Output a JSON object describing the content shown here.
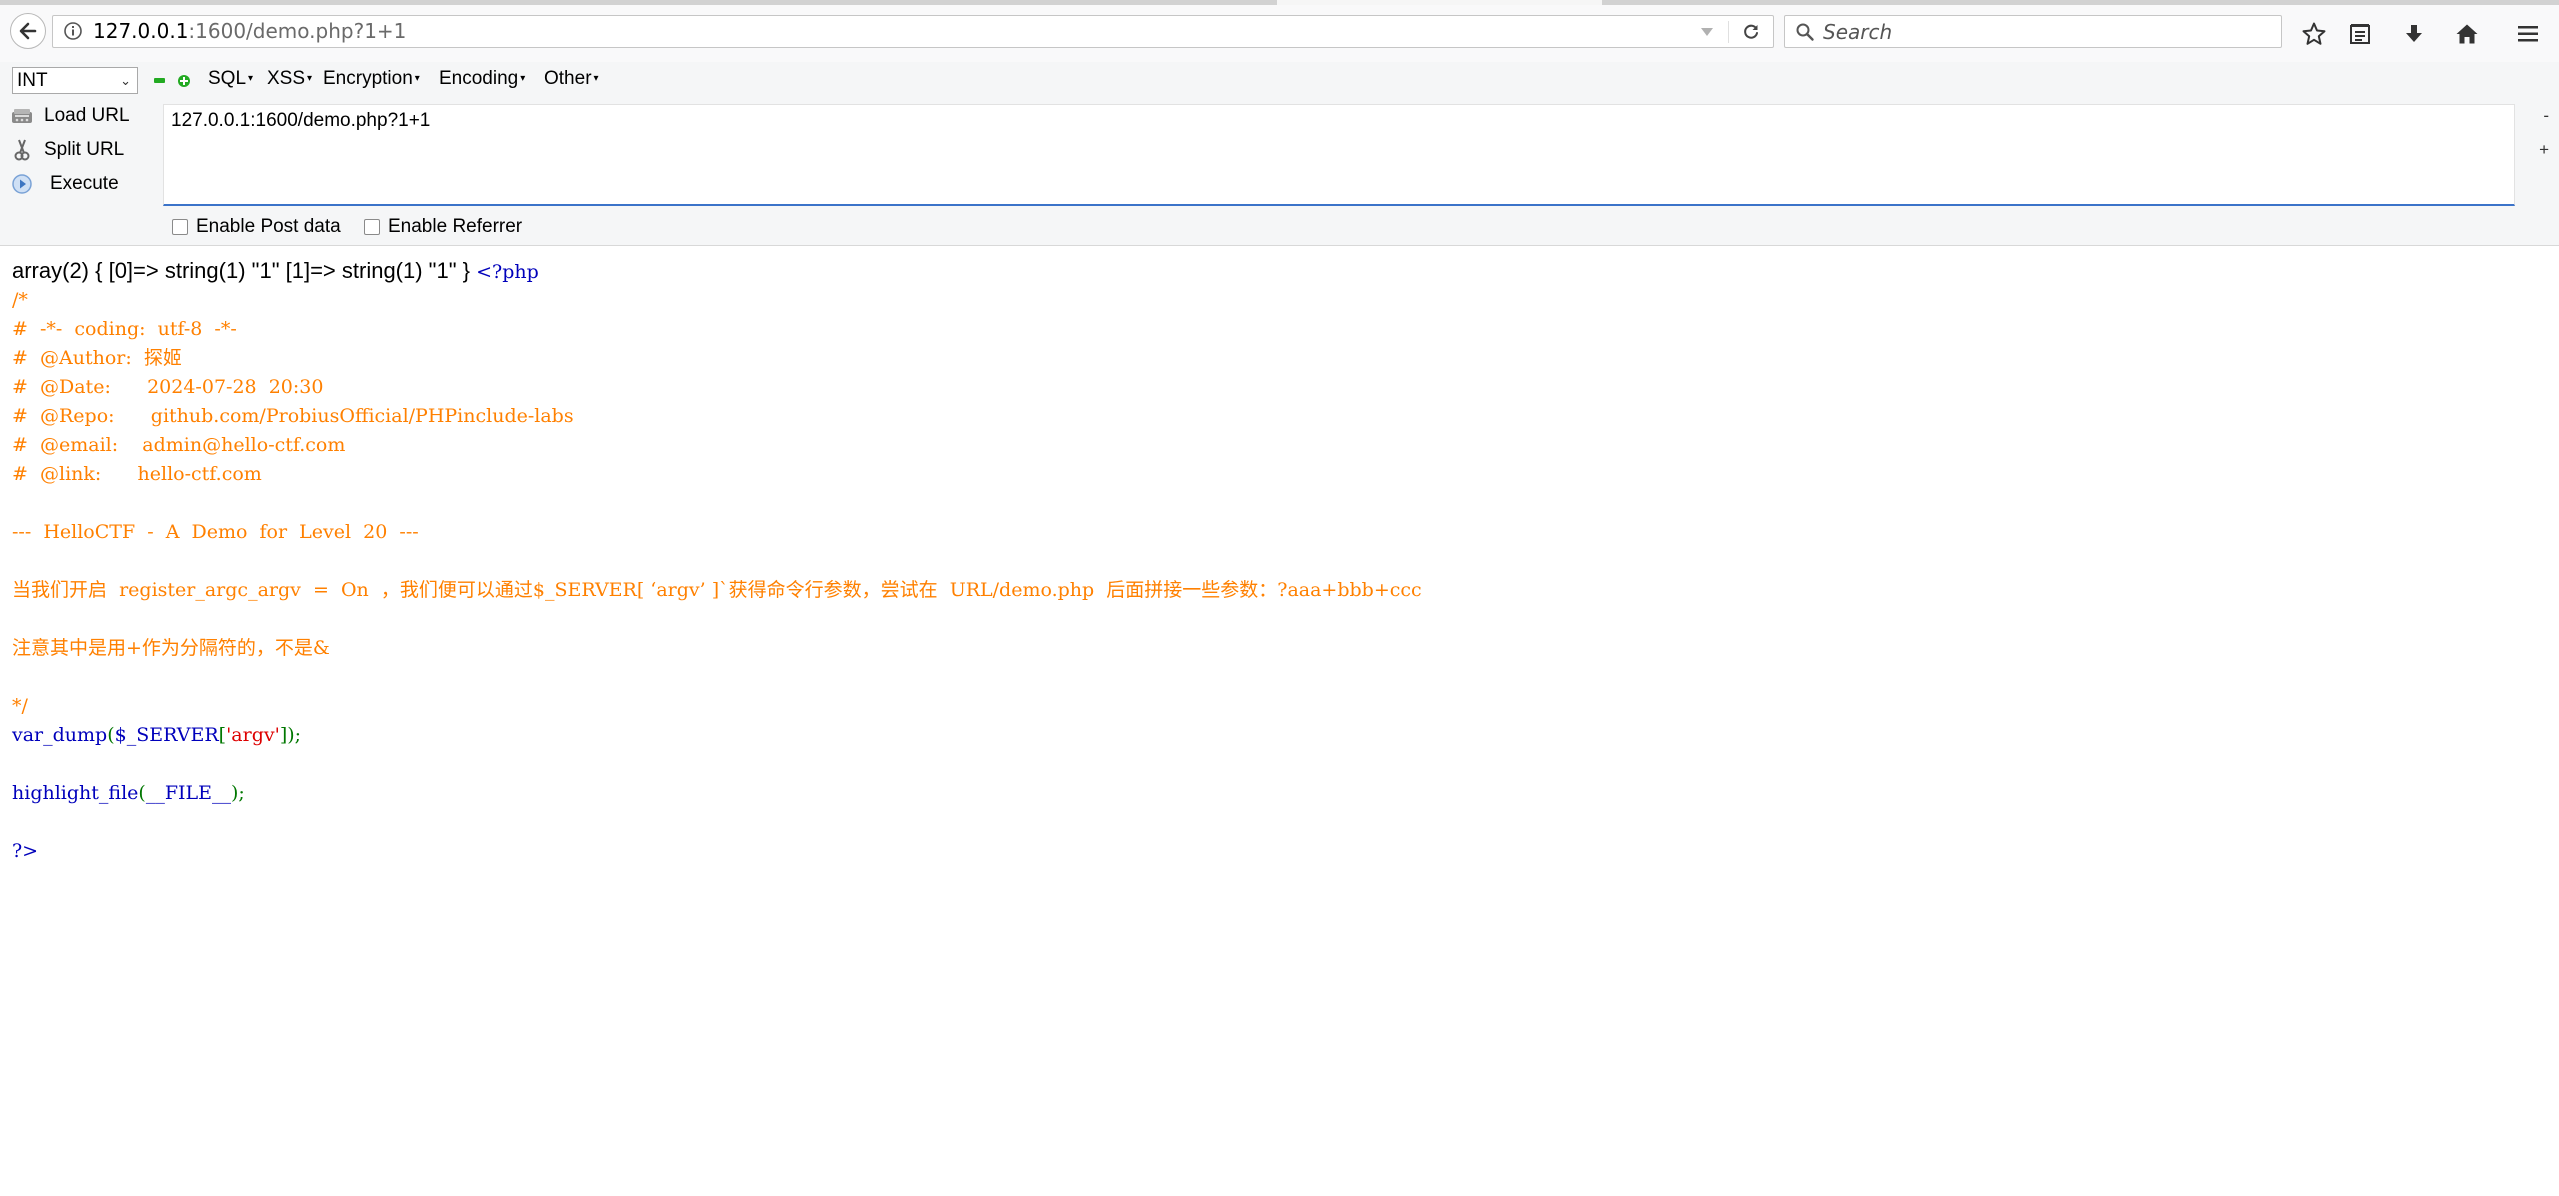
{
  "browser": {
    "url_host": "127.0.0.1",
    "url_rest": ":1600/demo.php?1+1",
    "search_placeholder": "Search",
    "icons": [
      "back-arrow-icon",
      "info-icon",
      "dropdown-arrow-icon",
      "reload-icon",
      "search-icon",
      "bookmark-star-icon",
      "reader-list-icon",
      "download-arrow-icon",
      "home-icon",
      "hamburger-menu-icon"
    ]
  },
  "hackbar": {
    "select_value": "INT",
    "menus": [
      "SQL",
      "XSS",
      "Encryption",
      "Encoding",
      "Other"
    ],
    "actions": {
      "load_url": "Load URL",
      "split_url": "Split URL",
      "execute": "Execute"
    },
    "url_value": "127.0.0.1:1600/demo.php?1+1",
    "side_minus": "-",
    "side_plus": "+",
    "enable_post": "Enable Post data",
    "enable_referrer": "Enable Referrer"
  },
  "page": {
    "dump_output": "array(2) { [0]=> string(1) \"1\" [1]=> string(1) \"1\" } ",
    "php_open": "<?php",
    "comment_lines": [
      "/*",
      "#  -*-  coding:  utf-8  -*-",
      "#  @Author:  探姬",
      "#  @Date:      2024-07-28  20:30",
      "#  @Repo:      github.com/ProbiusOfficial/PHPinclude-labs",
      "#  @email:    admin@hello-ctf.com",
      "#  @link:      hello-ctf.com",
      "",
      "---  HelloCTF  -  A  Demo  for  Level  20  ---",
      "",
      "当我们开启  register_argc_argv  =  On  ，我们便可以通过$_SERVER[ ‘argv’ ]`获得命令行参数，尝试在  URL/demo.php  后面拼接一些参数：?aaa+bbb+ccc",
      "",
      "注意其中是用+作为分隔符的，不是&",
      "",
      "*/"
    ],
    "code1": {
      "func": "var_dump",
      "open_paren": "(",
      "var": "$_SERVER",
      "open_bracket": "[",
      "string": "'argv'",
      "close": "]);"
    },
    "code2": {
      "func": "highlight_file",
      "open_paren": "(",
      "const": "__FILE__",
      "close": ");"
    },
    "php_close": "?>"
  },
  "colors": {
    "php_comment": "#ff8000",
    "php_default": "#0000bb",
    "php_keyword": "#007700",
    "php_string": "#dd0000",
    "urlbar_focus_border": "#3b73c9"
  }
}
